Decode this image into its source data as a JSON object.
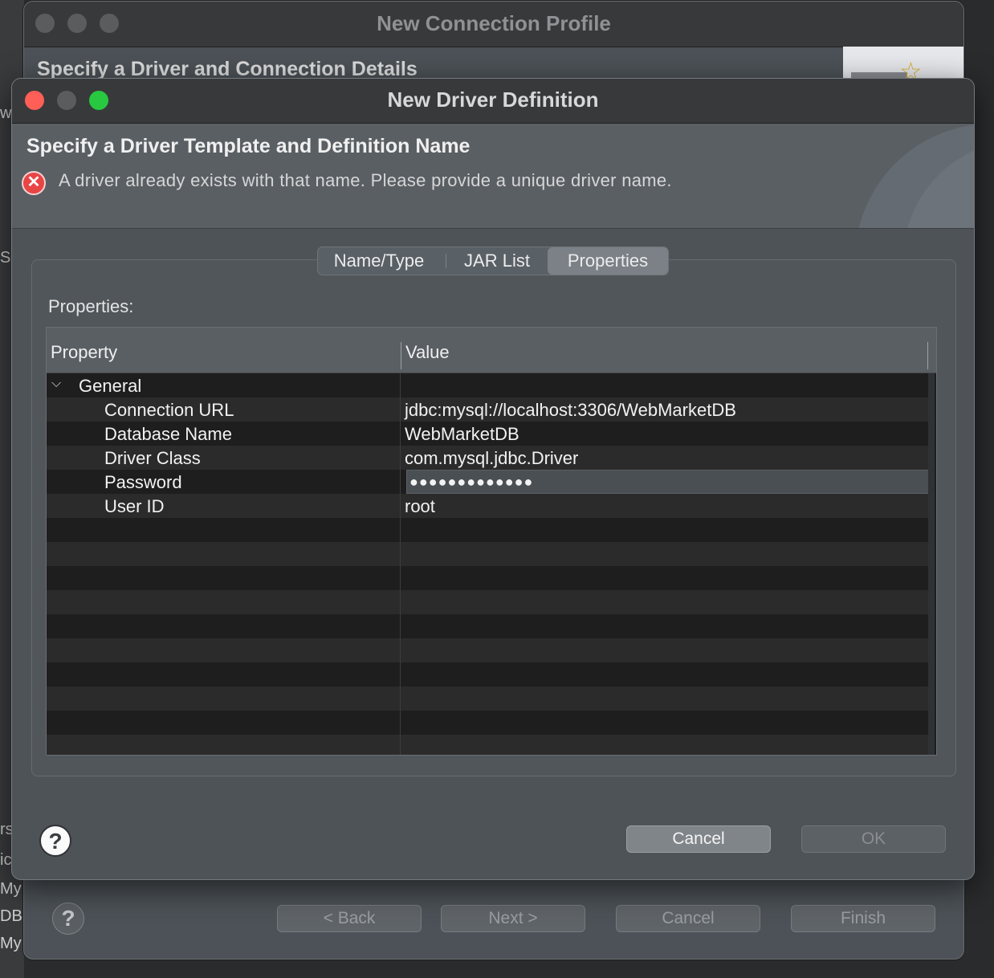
{
  "background": {
    "edge_texts": [
      "w",
      "S",
      "rs",
      "ic",
      "My",
      "DB",
      "My"
    ]
  },
  "back_window": {
    "title": "New Connection Profile",
    "header": "Specify a Driver and Connection Details",
    "buttons": {
      "back": "< Back",
      "next": "Next >",
      "cancel": "Cancel",
      "finish": "Finish"
    },
    "help": "?"
  },
  "dialog": {
    "title": "New Driver Definition",
    "heading": "Specify a Driver Template and Definition Name",
    "error_message": "A driver already exists with that name. Please provide a unique driver name.",
    "tabs": [
      "Name/Type",
      "JAR List",
      "Properties"
    ],
    "active_tab": "Properties",
    "properties_label": "Properties:",
    "table": {
      "columns": [
        "Property",
        "Value"
      ],
      "group": "General",
      "rows": [
        {
          "property": "Connection URL",
          "value": "jdbc:mysql://localhost:3306/WebMarketDB"
        },
        {
          "property": "Database Name",
          "value": "WebMarketDB"
        },
        {
          "property": "Driver Class",
          "value": "com.mysql.jdbc.Driver"
        },
        {
          "property": "Password",
          "value": "●●●●●●●●●●●●●"
        },
        {
          "property": "User ID",
          "value": "root"
        }
      ]
    },
    "buttons": {
      "cancel": "Cancel",
      "ok": "OK"
    },
    "help": "?"
  },
  "colors": {
    "close": "#ff5f57",
    "zoom": "#28c840",
    "error": "#e94545"
  }
}
